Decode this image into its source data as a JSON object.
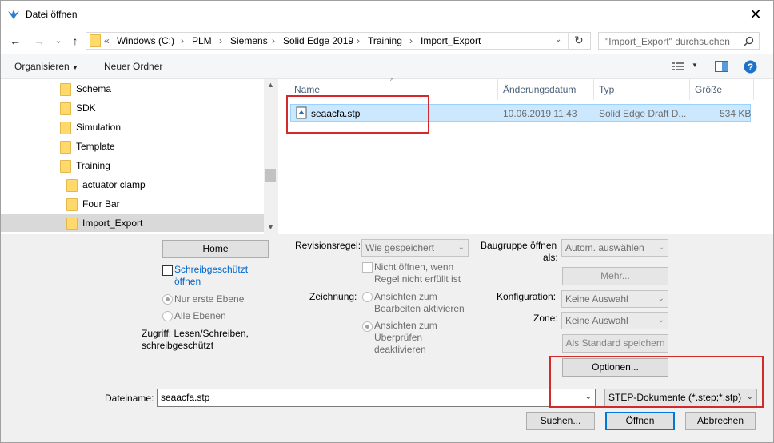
{
  "window": {
    "title": "Datei öffnen",
    "close_glyph": "✕"
  },
  "nav": {
    "back_glyph": "←",
    "forward_glyph": "→",
    "recent_glyph": "⌄",
    "up_glyph": "↑",
    "refresh_glyph": "↻",
    "breadcrumb": [
      "Windows (C:)",
      "PLM",
      "Siemens",
      "Solid Edge 2019",
      "Training",
      "Import_Export"
    ],
    "overflow": "«",
    "search_placeholder": "\"Import_Export\" durchsuchen"
  },
  "toolbar": {
    "organize": "Organisieren",
    "new_folder": "Neuer Ordner"
  },
  "tree": {
    "items": [
      {
        "label": "Schema"
      },
      {
        "label": "SDK"
      },
      {
        "label": "Simulation"
      },
      {
        "label": "Template"
      },
      {
        "label": "Training"
      },
      {
        "label": "actuator clamp"
      },
      {
        "label": "Four Bar"
      },
      {
        "label": "Import_Export"
      }
    ]
  },
  "filelist": {
    "columns": [
      "Name",
      "Änderungsdatum",
      "Typ",
      "Größe"
    ],
    "rows": [
      {
        "name": "seaacfa.stp",
        "date": "10.06.2019 11:43",
        "type": "Solid Edge Draft D...",
        "size": "534 KB"
      }
    ]
  },
  "options": {
    "home": "Home",
    "readonly_line1": "Schreibgeschützt",
    "readonly_line2": "öffnen",
    "first_level": "Nur erste Ebene",
    "all_levels": "Alle Ebenen",
    "access_line1": "Zugriff: Lesen/Schreiben,",
    "access_line2": "schreibgeschützt",
    "revision_rule_label": "Revisionsregel:",
    "revision_rule_value": "Wie gespeichert",
    "no_open_line1": "Nicht öffnen, wenn",
    "no_open_line2": "Regel nicht erfüllt ist",
    "drawing_label": "Zeichnung:",
    "views_edit_line1": "Ansichten zum",
    "views_edit_line2": "Bearbeiten aktivieren",
    "views_review_line1": "Ansichten zum",
    "views_review_line2": "Überprüfen",
    "views_review_line3": "deaktivieren",
    "assembly_open_line1": "Baugruppe öffnen",
    "assembly_open_line2": "als:",
    "assembly_value": "Autom. auswählen",
    "more_button": "Mehr...",
    "config_label": "Konfiguration:",
    "config_value": "Keine Auswahl",
    "zone_label": "Zone:",
    "zone_value": "Keine Auswahl",
    "set_default": "Als Standard speichern",
    "options_button": "Optionen..."
  },
  "footer": {
    "filename_label": "Dateiname:",
    "filename_value": "seaacfa.stp",
    "filetype_value": "STEP-Dokumente (*.step;*.stp)",
    "search_button": "Suchen...",
    "open_button": "Öffnen",
    "cancel_button": "Abbrechen"
  },
  "colors": {
    "accent": "#0078d7",
    "highlight": "#d22a2a",
    "selection": "#cce8ff"
  }
}
